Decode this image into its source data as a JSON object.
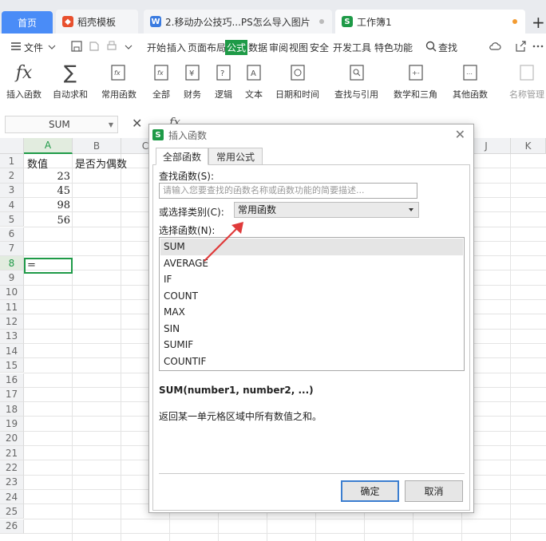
{
  "tabs": {
    "home": "首页",
    "template": "稻壳模板",
    "doc": "2.移动办公技巧...PS怎么导入图片",
    "workbook": "工作簿1",
    "add": "+"
  },
  "menu": {
    "file": "文件",
    "items": [
      "开始",
      "插入",
      "页面布局",
      "公式",
      "数据",
      "审阅",
      "视图",
      "安全",
      "开发工具",
      "特色功能"
    ],
    "selected": "公式",
    "search": "查找"
  },
  "ribbon": {
    "insert_function": "插入函数",
    "autosum": "自动求和",
    "common": "常用函数",
    "all": "全部",
    "finance": "财务",
    "logic": "逻辑",
    "text": "文本",
    "datetime": "日期和时间",
    "lookup": "查找与引用",
    "math": "数学和三角",
    "other": "其他函数",
    "name_manager": "名称管理"
  },
  "formula_bar": {
    "name_box": "SUM",
    "fx": "fx"
  },
  "sheet": {
    "columns": [
      "A",
      "B",
      "C",
      "D",
      "E",
      "F",
      "G",
      "H",
      "I",
      "J",
      "K"
    ],
    "rows": [
      "1",
      "2",
      "3",
      "4",
      "5",
      "6",
      "7",
      "8",
      "9",
      "10",
      "11",
      "12",
      "13",
      "14",
      "15",
      "16",
      "17",
      "18",
      "19",
      "20",
      "21",
      "22",
      "23",
      "24",
      "25",
      "26"
    ],
    "cells": {
      "a1": "数值",
      "b1": "是否为偶数",
      "a2": "23",
      "a3": "45",
      "a4": "98",
      "a5": "56",
      "a8": "="
    }
  },
  "dialog": {
    "title": "插入函数",
    "tab_all": "全部函数",
    "tab_common": "常用公式",
    "search_label": "查找函数(S):",
    "search_placeholder": "请输入您要查找的函数名称或函数功能的简要描述...",
    "category_label": "或选择类别(C):",
    "category_value": "常用函数",
    "select_label": "选择函数(N):",
    "functions": [
      "SUM",
      "AVERAGE",
      "IF",
      "COUNT",
      "MAX",
      "SIN",
      "SUMIF",
      "COUNTIF"
    ],
    "signature": "SUM(number1, number2, ...)",
    "description": "返回某一单元格区域中所有数值之和。",
    "ok": "确定",
    "cancel": "取消"
  },
  "colors": {
    "accent": "#1e9a47",
    "home_tab": "#4a8cf7",
    "arrow": "#e03a3a"
  }
}
